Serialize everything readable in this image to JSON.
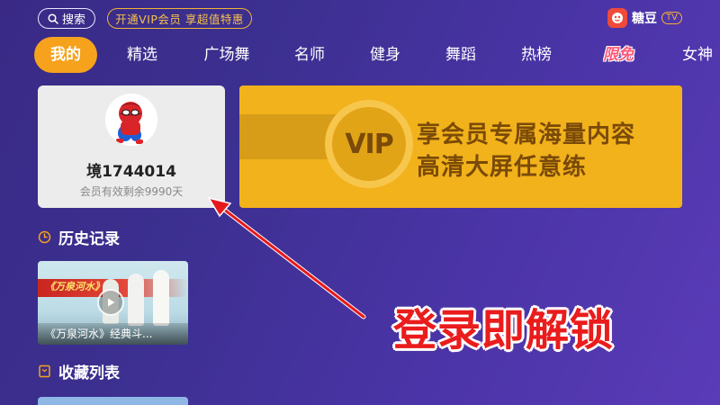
{
  "topbar": {
    "search_label": "搜索",
    "vip_promo": "开通VIP会员 享超值特惠",
    "brand_name": "糖豆",
    "brand_tv": "TV"
  },
  "nav": {
    "tabs": [
      {
        "label": "我的",
        "active": true
      },
      {
        "label": "精选"
      },
      {
        "label": "广场舞"
      },
      {
        "label": "名师"
      },
      {
        "label": "健身"
      },
      {
        "label": "舞蹈"
      },
      {
        "label": "热榜"
      },
      {
        "label": "限免",
        "style": "badge"
      },
      {
        "label": "女神"
      }
    ]
  },
  "profile": {
    "username": "境1744014",
    "membership": "会员有效剩余9990天"
  },
  "vip_banner": {
    "badge": "VIP",
    "line1": "享会员专属海量内容",
    "line2": "高清大屏任意练"
  },
  "history": {
    "heading": "历史记录",
    "items": [
      {
        "title": "《万泉河水》经典斗...",
        "art_title": "《万泉河水》"
      }
    ]
  },
  "favorites": {
    "heading": "收藏列表"
  },
  "annotation": {
    "text": "登录即解锁"
  },
  "colors": {
    "accent": "#f6a21c",
    "vip_gold": "#f2b21b",
    "annotation_red": "#ea1c1c"
  }
}
